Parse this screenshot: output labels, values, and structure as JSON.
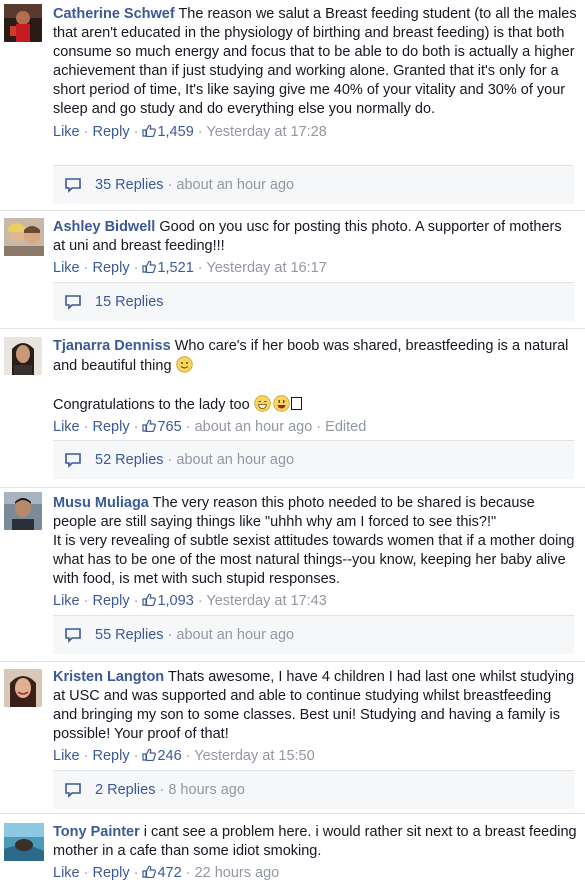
{
  "comments": [
    {
      "author": "Catherine Schwef",
      "text": "The reason we salut a Breast feeding student (to all the males that aren't educated in the physiology of birthing and breast feeding) is that both consume so much energy and focus that to be able to do both is actually a higher achievement than if just studying and working alone. Granted that it's only for a short period of time, It's like saying give me 40% of your vitality and 30% of your sleep and go study and do everything else you normally do.",
      "like": "Like",
      "reply": "Reply",
      "likes": "1,459",
      "time": "Yesterday at 17:28",
      "replies_count": "35 Replies",
      "replies_time": "about an hour ago"
    },
    {
      "author": "Ashley Bidwell",
      "text": "Good on you usc for posting this photo. A supporter of mothers at uni and breast feeding!!!",
      "like": "Like",
      "reply": "Reply",
      "likes": "1,521",
      "time": "Yesterday at 16:17",
      "replies_count": "15 Replies",
      "replies_time": ""
    },
    {
      "author": "Tjanarra Denniss",
      "text": "Who care's if her boob was shared, breastfeeding is a natural and beautiful thing",
      "text2": "Congratulations to the lady too",
      "like": "Like",
      "reply": "Reply",
      "likes": "765",
      "time": "about an hour ago",
      "edited": "Edited",
      "replies_count": "52 Replies",
      "replies_time": "about an hour ago"
    },
    {
      "author": "Musu Muliaga",
      "text": "The very reason this photo needed to be shared is because people are still saying things like \"uhhh why am I forced to see this?!\"",
      "text2": "It is very revealing of subtle sexist attitudes towards women that if a mother doing what has to be one of the most natural things--you know, keeping her baby alive with food, is met with such stupid responses.",
      "like": "Like",
      "reply": "Reply",
      "likes": "1,093",
      "time": "Yesterday at 17:43",
      "replies_count": "55 Replies",
      "replies_time": "about an hour ago"
    },
    {
      "author": "Kristen Langton",
      "text": "Thats awesome, I have 4 children I had last one whilst studying at USC and was supported and able to continue studying whilst breastfeeding and bringing my son to some classes. Best uni! Studying and having a family is possible! Your proof of that!",
      "like": "Like",
      "reply": "Reply",
      "likes": "246",
      "time": "Yesterday at 15:50",
      "replies_count": "2 Replies",
      "replies_time": "8 hours ago"
    },
    {
      "author": "Tony Painter",
      "text": "i cant see a problem here. i would rather sit next to a breast feeding mother in a cafe than some idiot smoking.",
      "like": "Like",
      "reply": "Reply",
      "likes": "472",
      "time": "22 hours ago"
    }
  ],
  "colors": {
    "link": "#3b5998",
    "muted": "#9197a3",
    "text": "#141823",
    "reply_bg": "#f6f7f9"
  }
}
